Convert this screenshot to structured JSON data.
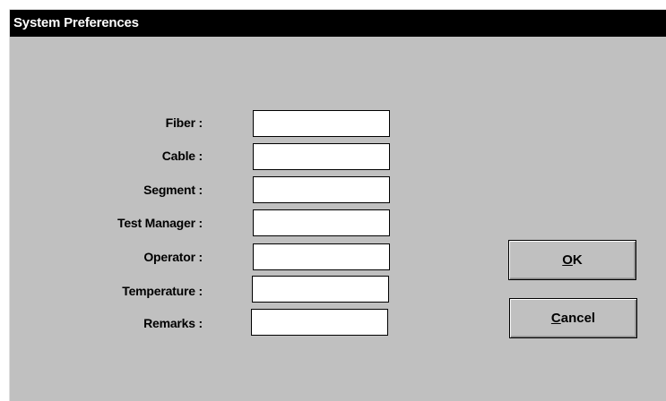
{
  "window": {
    "title": "System Preferences"
  },
  "fields": [
    {
      "label": "Fiber :",
      "value": ""
    },
    {
      "label": "Cable :",
      "value": ""
    },
    {
      "label": "Segment :",
      "value": ""
    },
    {
      "label": "Test Manager :",
      "value": ""
    },
    {
      "label": "Operator :",
      "value": ""
    },
    {
      "label": "Temperature :",
      "value": ""
    },
    {
      "label": "Remarks :",
      "value": ""
    }
  ],
  "buttons": {
    "ok": {
      "mnemonic": "O",
      "rest": "K"
    },
    "cancel": {
      "mnemonic": "C",
      "rest": "ancel"
    }
  }
}
